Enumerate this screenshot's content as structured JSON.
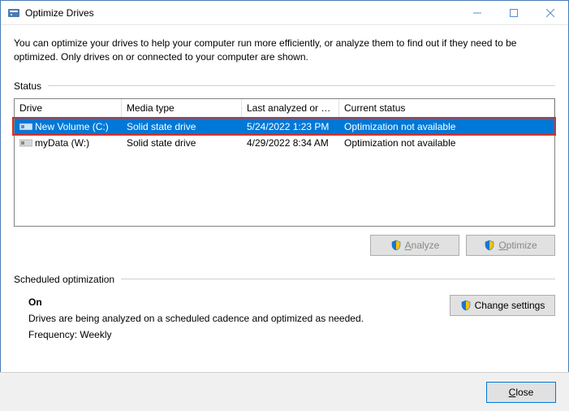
{
  "window": {
    "title": "Optimize Drives"
  },
  "intro": "You can optimize your drives to help your computer run more efficiently, or analyze them to find out if they need to be optimized. Only drives on or connected to your computer are shown.",
  "status_label": "Status",
  "columns": {
    "drive": "Drive",
    "media": "Media type",
    "last": "Last analyzed or o...",
    "status": "Current status"
  },
  "drives": [
    {
      "name": "New Volume (C:)",
      "media": "Solid state drive",
      "last": "5/24/2022 1:23 PM",
      "status": "Optimization not available",
      "selected": true
    },
    {
      "name": "myData (W:)",
      "media": "Solid state drive",
      "last": "4/29/2022 8:34 AM",
      "status": "Optimization not available",
      "selected": false
    }
  ],
  "buttons": {
    "analyze": "Analyze",
    "optimize": "Optimize",
    "change_settings": "Change settings",
    "close": "Close"
  },
  "scheduled": {
    "label": "Scheduled optimization",
    "on": "On",
    "desc": "Drives are being analyzed on a scheduled cadence and optimized as needed.",
    "freq": "Frequency: Weekly"
  }
}
